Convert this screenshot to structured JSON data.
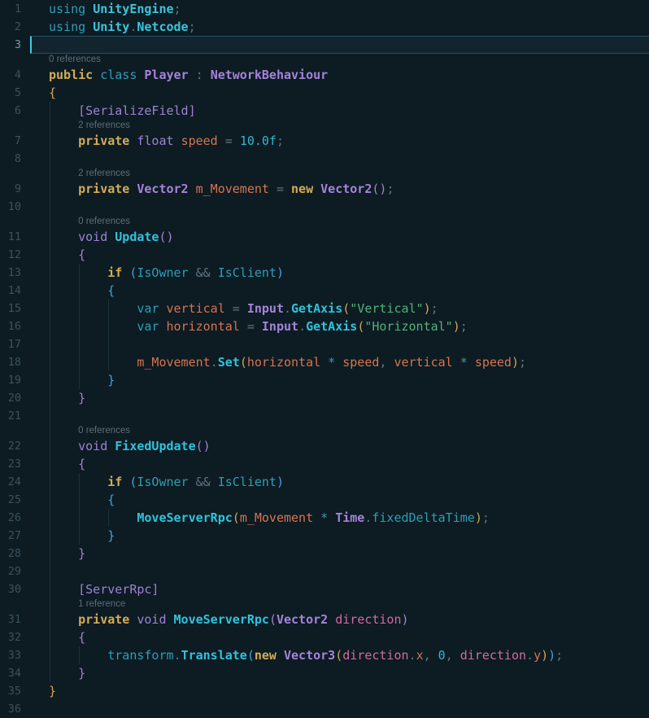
{
  "editor": {
    "language": "csharp",
    "cursor_line": 3,
    "colors": {
      "background": "#0d1b23",
      "cursor": "#46c9dd",
      "current_line_bg": "#12242e",
      "current_line_border": "#27525f",
      "line_number": "#3b525c",
      "line_number_active": "#7d97a2",
      "codelens_text": "#5d6e77",
      "indent_guide": "#1d323c",
      "keyword_teal": "#2d9fb5",
      "keyword_gold": "#d3ac55",
      "type_purple": "#a583d9",
      "method_cyan": "#30c3dc",
      "field_orange": "#d8744f",
      "parameter_pink": "#cf6d9f",
      "string_green": "#4fb578",
      "number_cyan": "#2fb9d4",
      "punctuation_grey": "#5f7480",
      "bracket_gold": "#cfa94e",
      "bracket_orchid": "#a87fd1",
      "bracket_blue": "#3fa3dd"
    },
    "lines": [
      {
        "t": "c",
        "n": 1,
        "guides": [],
        "tok": [
          [
            "kw",
            "using "
          ],
          [
            "ns",
            "UnityEngine"
          ],
          [
            "punc",
            ";"
          ]
        ]
      },
      {
        "t": "c",
        "n": 2,
        "guides": [],
        "tok": [
          [
            "kw",
            "using "
          ],
          [
            "ns",
            "Unity"
          ],
          [
            "punc",
            "."
          ],
          [
            "ns",
            "Netcode"
          ],
          [
            "punc",
            ";"
          ]
        ]
      },
      {
        "t": "c",
        "n": 3,
        "guides": [],
        "cur": true,
        "tok": []
      },
      {
        "t": "cl",
        "text": "0 references",
        "indent": 0,
        "guides": []
      },
      {
        "t": "c",
        "n": 4,
        "guides": [],
        "tok": [
          [
            "gold",
            "public "
          ],
          [
            "kw",
            "class "
          ],
          [
            "type",
            "Player"
          ],
          [
            "punc",
            " : "
          ],
          [
            "type",
            "NetworkBehaviour"
          ]
        ]
      },
      {
        "t": "c",
        "n": 5,
        "guides": [],
        "tok": [
          [
            "b1",
            "{"
          ]
        ]
      },
      {
        "t": "c",
        "n": 6,
        "guides": [
          0
        ],
        "tok": [
          [
            "ws",
            "    "
          ],
          [
            "prim",
            "[SerializeField]"
          ]
        ]
      },
      {
        "t": "cl",
        "text": "2 references",
        "indent": 4,
        "guides": [
          0
        ]
      },
      {
        "t": "c",
        "n": 7,
        "guides": [
          0
        ],
        "tok": [
          [
            "ws",
            "    "
          ],
          [
            "gold",
            "private "
          ],
          [
            "prim",
            "float "
          ],
          [
            "field",
            "speed"
          ],
          [
            "punc",
            " = "
          ],
          [
            "num",
            "10.0f"
          ],
          [
            "punc",
            ";"
          ]
        ]
      },
      {
        "t": "c",
        "n": 8,
        "guides": [
          0
        ],
        "tok": []
      },
      {
        "t": "cl",
        "text": "2 references",
        "indent": 4,
        "guides": [
          0
        ]
      },
      {
        "t": "c",
        "n": 9,
        "guides": [
          0
        ],
        "tok": [
          [
            "ws",
            "    "
          ],
          [
            "gold",
            "private "
          ],
          [
            "type",
            "Vector2"
          ],
          [
            "ws",
            " "
          ],
          [
            "field",
            "m_Movement"
          ],
          [
            "punc",
            " = "
          ],
          [
            "gold",
            "new "
          ],
          [
            "type",
            "Vector2"
          ],
          [
            "b2",
            "()"
          ],
          [
            "punc",
            ";"
          ]
        ]
      },
      {
        "t": "c",
        "n": 10,
        "guides": [
          0
        ],
        "tok": []
      },
      {
        "t": "cl",
        "text": "0 references",
        "indent": 4,
        "guides": [
          0
        ]
      },
      {
        "t": "c",
        "n": 11,
        "guides": [
          0
        ],
        "tok": [
          [
            "ws",
            "    "
          ],
          [
            "prim",
            "void "
          ],
          [
            "meth",
            "Update"
          ],
          [
            "b2",
            "()"
          ]
        ]
      },
      {
        "t": "c",
        "n": 12,
        "guides": [
          0
        ],
        "tok": [
          [
            "ws",
            "    "
          ],
          [
            "b2",
            "{"
          ]
        ]
      },
      {
        "t": "c",
        "n": 13,
        "guides": [
          0,
          4
        ],
        "tok": [
          [
            "ws",
            "        "
          ],
          [
            "gold",
            "if "
          ],
          [
            "b3",
            "("
          ],
          [
            "prop",
            "IsOwner"
          ],
          [
            "punc",
            " && "
          ],
          [
            "prop",
            "IsClient"
          ],
          [
            "b3",
            ")"
          ]
        ]
      },
      {
        "t": "c",
        "n": 14,
        "guides": [
          0,
          4
        ],
        "tok": [
          [
            "ws",
            "        "
          ],
          [
            "b3",
            "{"
          ]
        ]
      },
      {
        "t": "c",
        "n": 15,
        "guides": [
          0,
          4,
          8
        ],
        "tok": [
          [
            "ws",
            "            "
          ],
          [
            "kw",
            "var "
          ],
          [
            "field",
            "vertical"
          ],
          [
            "punc",
            " = "
          ],
          [
            "type",
            "Input"
          ],
          [
            "punc",
            "."
          ],
          [
            "meth",
            "GetAxis"
          ],
          [
            "b1",
            "("
          ],
          [
            "str",
            "\"Vertical\""
          ],
          [
            "b1",
            ")"
          ],
          [
            "punc",
            ";"
          ]
        ]
      },
      {
        "t": "c",
        "n": 16,
        "guides": [
          0,
          4,
          8
        ],
        "tok": [
          [
            "ws",
            "            "
          ],
          [
            "kw",
            "var "
          ],
          [
            "field",
            "horizontal"
          ],
          [
            "punc",
            " = "
          ],
          [
            "type",
            "Input"
          ],
          [
            "punc",
            "."
          ],
          [
            "meth",
            "GetAxis"
          ],
          [
            "b1",
            "("
          ],
          [
            "str",
            "\"Horizontal\""
          ],
          [
            "b1",
            ")"
          ],
          [
            "punc",
            ";"
          ]
        ]
      },
      {
        "t": "c",
        "n": 17,
        "guides": [
          0,
          4,
          8
        ],
        "tok": []
      },
      {
        "t": "c",
        "n": 18,
        "guides": [
          0,
          4,
          8
        ],
        "tok": [
          [
            "ws",
            "            "
          ],
          [
            "field",
            "m_Movement"
          ],
          [
            "punc",
            "."
          ],
          [
            "meth",
            "Set"
          ],
          [
            "b1",
            "("
          ],
          [
            "field",
            "horizontal"
          ],
          [
            "op",
            " * "
          ],
          [
            "field",
            "speed"
          ],
          [
            "punc",
            ", "
          ],
          [
            "field",
            "vertical"
          ],
          [
            "op",
            " * "
          ],
          [
            "field",
            "speed"
          ],
          [
            "b1",
            ")"
          ],
          [
            "punc",
            ";"
          ]
        ]
      },
      {
        "t": "c",
        "n": 19,
        "guides": [
          0,
          4
        ],
        "tok": [
          [
            "ws",
            "        "
          ],
          [
            "b3",
            "}"
          ]
        ]
      },
      {
        "t": "c",
        "n": 20,
        "guides": [
          0
        ],
        "tok": [
          [
            "ws",
            "    "
          ],
          [
            "b2",
            "}"
          ]
        ]
      },
      {
        "t": "c",
        "n": 21,
        "guides": [
          0
        ],
        "tok": []
      },
      {
        "t": "cl",
        "text": "0 references",
        "indent": 4,
        "guides": [
          0
        ]
      },
      {
        "t": "c",
        "n": 22,
        "guides": [
          0
        ],
        "tok": [
          [
            "ws",
            "    "
          ],
          [
            "prim",
            "void "
          ],
          [
            "meth",
            "FixedUpdate"
          ],
          [
            "b2",
            "()"
          ]
        ]
      },
      {
        "t": "c",
        "n": 23,
        "guides": [
          0
        ],
        "tok": [
          [
            "ws",
            "    "
          ],
          [
            "b2",
            "{"
          ]
        ]
      },
      {
        "t": "c",
        "n": 24,
        "guides": [
          0,
          4
        ],
        "tok": [
          [
            "ws",
            "        "
          ],
          [
            "gold",
            "if "
          ],
          [
            "b3",
            "("
          ],
          [
            "prop",
            "IsOwner"
          ],
          [
            "punc",
            " && "
          ],
          [
            "prop",
            "IsClient"
          ],
          [
            "b3",
            ")"
          ]
        ]
      },
      {
        "t": "c",
        "n": 25,
        "guides": [
          0,
          4
        ],
        "tok": [
          [
            "ws",
            "        "
          ],
          [
            "b3",
            "{"
          ]
        ]
      },
      {
        "t": "c",
        "n": 26,
        "guides": [
          0,
          4,
          8
        ],
        "tok": [
          [
            "ws",
            "            "
          ],
          [
            "meth",
            "MoveServerRpc"
          ],
          [
            "b1",
            "("
          ],
          [
            "field",
            "m_Movement"
          ],
          [
            "op",
            " * "
          ],
          [
            "type",
            "Time"
          ],
          [
            "punc",
            "."
          ],
          [
            "prop",
            "fixedDeltaTime"
          ],
          [
            "b1",
            ")"
          ],
          [
            "punc",
            ";"
          ]
        ]
      },
      {
        "t": "c",
        "n": 27,
        "guides": [
          0,
          4
        ],
        "tok": [
          [
            "ws",
            "        "
          ],
          [
            "b3",
            "}"
          ]
        ]
      },
      {
        "t": "c",
        "n": 28,
        "guides": [
          0
        ],
        "tok": [
          [
            "ws",
            "    "
          ],
          [
            "b2",
            "}"
          ]
        ]
      },
      {
        "t": "c",
        "n": 29,
        "guides": [
          0
        ],
        "tok": []
      },
      {
        "t": "c",
        "n": 30,
        "guides": [
          0
        ],
        "tok": [
          [
            "ws",
            "    "
          ],
          [
            "prim",
            "[ServerRpc]"
          ]
        ]
      },
      {
        "t": "cl",
        "text": "1 reference",
        "indent": 4,
        "guides": [
          0
        ]
      },
      {
        "t": "c",
        "n": 31,
        "guides": [
          0
        ],
        "tok": [
          [
            "ws",
            "    "
          ],
          [
            "gold",
            "private "
          ],
          [
            "prim",
            "void "
          ],
          [
            "meth",
            "MoveServerRpc"
          ],
          [
            "b2",
            "("
          ],
          [
            "type",
            "Vector2"
          ],
          [
            "ws",
            " "
          ],
          [
            "param",
            "direction"
          ],
          [
            "b2",
            ")"
          ]
        ]
      },
      {
        "t": "c",
        "n": 32,
        "guides": [
          0
        ],
        "tok": [
          [
            "ws",
            "    "
          ],
          [
            "b2",
            "{"
          ]
        ]
      },
      {
        "t": "c",
        "n": 33,
        "guides": [
          0,
          4
        ],
        "tok": [
          [
            "ws",
            "        "
          ],
          [
            "prop",
            "transform"
          ],
          [
            "punc",
            "."
          ],
          [
            "meth",
            "Translate"
          ],
          [
            "b3",
            "("
          ],
          [
            "gold",
            "new "
          ],
          [
            "type",
            "Vector3"
          ],
          [
            "b1",
            "("
          ],
          [
            "param",
            "direction"
          ],
          [
            "punc",
            "."
          ],
          [
            "field",
            "x"
          ],
          [
            "punc",
            ", "
          ],
          [
            "num",
            "0"
          ],
          [
            "punc",
            ", "
          ],
          [
            "param",
            "direction"
          ],
          [
            "punc",
            "."
          ],
          [
            "field",
            "y"
          ],
          [
            "b1",
            ")"
          ],
          [
            "b3",
            ")"
          ],
          [
            "punc",
            ";"
          ]
        ]
      },
      {
        "t": "c",
        "n": 34,
        "guides": [
          0
        ],
        "tok": [
          [
            "ws",
            "    "
          ],
          [
            "b2",
            "}"
          ]
        ]
      },
      {
        "t": "c",
        "n": 35,
        "guides": [],
        "tok": [
          [
            "b1",
            "}"
          ]
        ]
      },
      {
        "t": "c",
        "n": 36,
        "guides": [],
        "tok": []
      }
    ]
  }
}
